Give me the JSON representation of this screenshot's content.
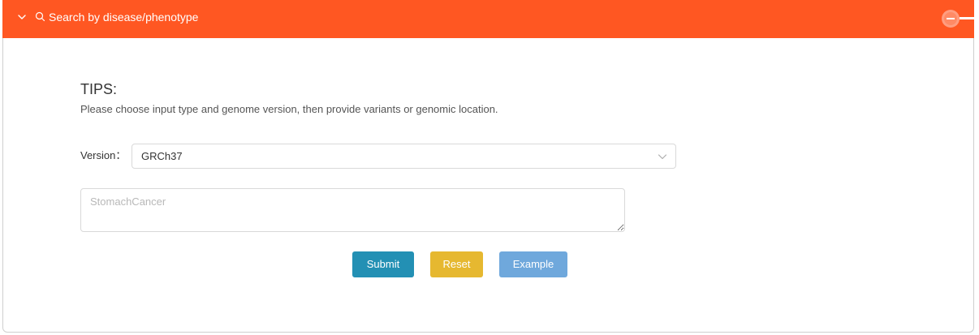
{
  "header": {
    "title": "Search by disease/phenotype",
    "expand_icon": "chevron-down-icon",
    "search_icon": "search-icon",
    "collapse_icon": "minus-circle-icon",
    "color": "#ff5722"
  },
  "tips": {
    "title": "TIPS:",
    "text": "Please choose input type and genome version, then provide variants or genomic location."
  },
  "version": {
    "label": "Version",
    "separator": "：",
    "selected": "GRCh37"
  },
  "query": {
    "placeholder": "StomachCancer",
    "value": ""
  },
  "buttons": {
    "submit": "Submit",
    "reset": "Reset",
    "example": "Example",
    "submit_color": "#2390b4",
    "reset_color": "#e6b830",
    "example_color": "#6fa8dc"
  }
}
